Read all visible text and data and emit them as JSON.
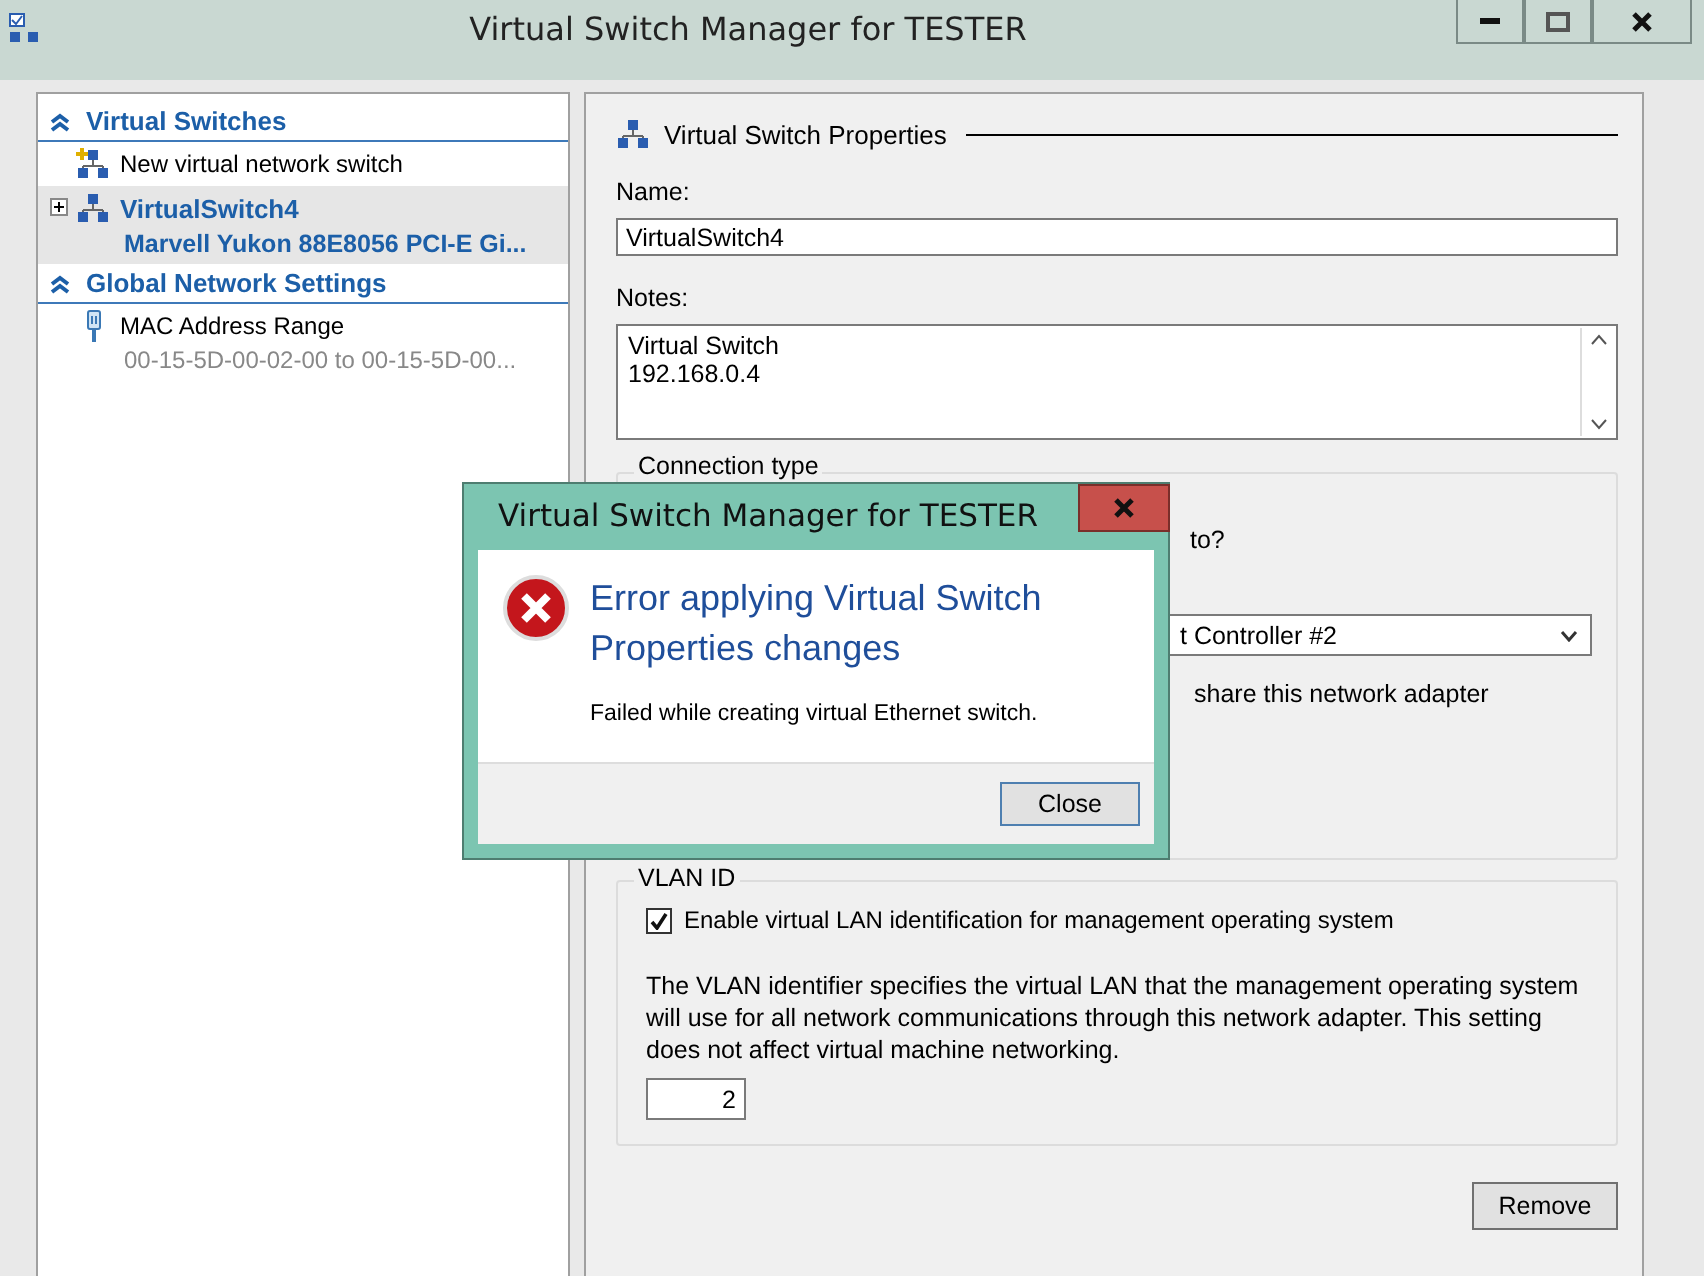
{
  "window": {
    "title": "Virtual Switch Manager for TESTER"
  },
  "sidebar": {
    "sections": [
      {
        "title": "Virtual Switches",
        "expanded": true,
        "items": [
          {
            "kind": "new",
            "label": "New virtual network switch",
            "selected": false
          },
          {
            "kind": "switch",
            "label": "VirtualSwitch4",
            "sublabel": "Marvell Yukon 88E8056 PCI-E Gi...",
            "selected": true,
            "expanded": false
          }
        ]
      },
      {
        "title": "Global Network Settings",
        "expanded": true,
        "items": [
          {
            "kind": "mac",
            "label": "MAC Address Range",
            "sublabel": "00-15-5D-00-02-00 to 00-15-5D-00...",
            "selected": false
          }
        ]
      }
    ]
  },
  "properties": {
    "title": "Virtual Switch Properties",
    "name_label": "Name:",
    "name_value": "VirtualSwitch4",
    "notes_label": "Notes:",
    "notes_value": "Virtual Switch\n192.168.0.4"
  },
  "connection": {
    "legend": "Connection type",
    "question": "to?",
    "adapter_value": "t Controller #2",
    "share_label": "share this network adapter"
  },
  "vlan": {
    "legend": "VLAN ID",
    "enable_label": "Enable virtual LAN identification for management operating system",
    "enabled": true,
    "description": "The VLAN identifier specifies the virtual LAN that the management operating system will use for all network communications through this network adapter. This setting does not affect virtual machine networking.",
    "value": "2"
  },
  "remove_button": "Remove",
  "dialog": {
    "title": "Virtual Switch Manager for TESTER",
    "heading": "Error applying Virtual Switch Properties changes",
    "message": "Failed while creating virtual Ethernet switch.",
    "button": "Close"
  }
}
